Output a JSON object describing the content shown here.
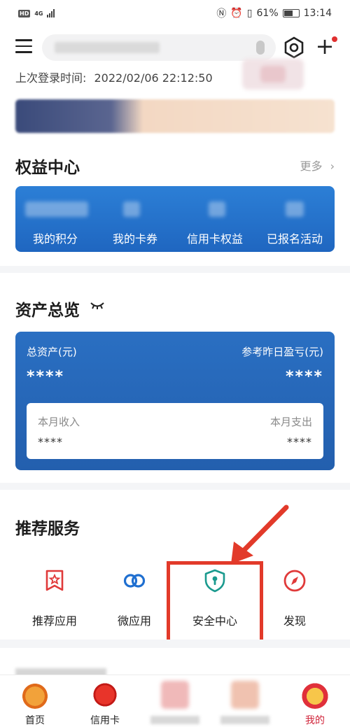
{
  "status_bar": {
    "network": "4G",
    "battery": "61%",
    "time": "13:14"
  },
  "header": {
    "menu_icon": "hamburger-menu-icon",
    "scan_icon": "hexagon-scan-icon",
    "add_icon": "plus-icon"
  },
  "last_login": {
    "label": "上次登录时间:",
    "value": "2022/02/06 22:12:50"
  },
  "rights": {
    "title": "权益中心",
    "more": "更多",
    "items": [
      "我的积分",
      "我的卡券",
      "信用卡权益",
      "已报名活动"
    ]
  },
  "assets": {
    "title": "资产总览",
    "total_label": "总资产(元)",
    "total_value": "****",
    "yesterday_label": "参考昨日盈亏(元)",
    "yesterday_value": "****",
    "income_label": "本月收入",
    "income_value": "****",
    "expense_label": "本月支出",
    "expense_value": "****"
  },
  "services": {
    "title": "推荐服务",
    "items": [
      {
        "label": "推荐应用",
        "icon": "star-flag-icon"
      },
      {
        "label": "微应用",
        "icon": "link-rings-icon"
      },
      {
        "label": "安全中心",
        "icon": "shield-lock-icon"
      },
      {
        "label": "发现",
        "icon": "compass-icon"
      }
    ]
  },
  "tabbar": {
    "items": [
      {
        "label": "首页",
        "icon": "tiger-icon"
      },
      {
        "label": "信用卡",
        "icon": "lantern-icon"
      },
      {
        "label": "",
        "icon": "blurred-icon"
      },
      {
        "label": "",
        "icon": "blurred-icon"
      },
      {
        "label": "我的",
        "icon": "lion-mascot-icon"
      }
    ]
  },
  "colors": {
    "brand_blue": "#2a6fc2",
    "highlight_red": "#e23a2a",
    "active_tab": "#d0243a"
  }
}
